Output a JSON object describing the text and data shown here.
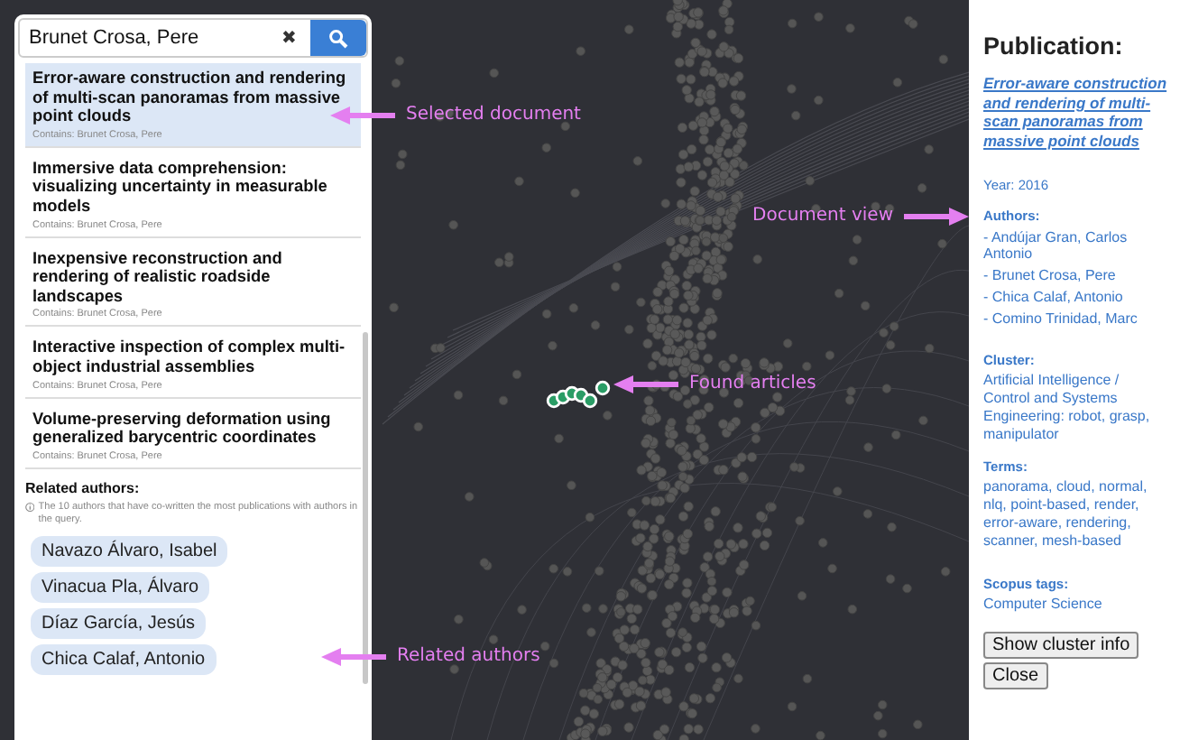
{
  "search": {
    "value": "Brunet Crosa, Pere",
    "clear": "✖"
  },
  "results": [
    {
      "title": "Error-aware construction and rendering of multi-scan panoramas from massive point clouds",
      "contains": "Contains: Brunet Crosa, Pere",
      "selected": true
    },
    {
      "title": "Immersive data comprehension: visualizing uncertainty in measurable models",
      "contains": "Contains: Brunet Crosa, Pere",
      "selected": false
    },
    {
      "title": "Inexpensive reconstruction and rendering of realistic roadside landscapes",
      "contains": "Contains: Brunet Crosa, Pere",
      "selected": false
    },
    {
      "title": "Interactive inspection of complex multi-object industrial assemblies",
      "contains": "Contains: Brunet Crosa, Pere",
      "selected": false
    },
    {
      "title": "Volume-preserving deformation using generalized barycentric coordinates",
      "contains": "Contains: Brunet Crosa, Pere",
      "selected": false
    }
  ],
  "related_authors": {
    "heading": "Related authors:",
    "note": "The 10 authors that have co-written the most publications with authors in the query.",
    "authors": [
      "Navazo Álvaro, Isabel",
      "Vinacua Pla, Álvaro",
      "Díaz García, Jesús",
      "Chica Calaf, Antonio"
    ]
  },
  "publication": {
    "heading": "Publication:",
    "title": "Error-aware construction and rendering of multi-scan panoramas from massive point clouds",
    "year": "Year: 2016",
    "authors_label": "Authors:",
    "authors": [
      "- Andújar Gran, Carlos Antonio",
      "- Brunet Crosa, Pere",
      "- Chica Calaf, Antonio",
      "- Comino Trinidad, Marc"
    ],
    "cluster_label": "Cluster:",
    "cluster": "Artificial Intelligence / Control and Systems Engineering: robot, grasp, manipulator",
    "terms_label": "Terms:",
    "terms": "panorama, cloud, normal, nlq, point-based, render, error-aware, rendering, scanner, mesh-based",
    "scopus_label": "Scopus tags:",
    "scopus": "Computer Science",
    "buttons": [
      "Show cluster info",
      "Close"
    ]
  },
  "annotations": [
    {
      "text": "Selected document",
      "kind": "arrow-left"
    },
    {
      "text": "Document view",
      "kind": "arrow-right"
    },
    {
      "text": "Found articles",
      "kind": "arrow-left"
    },
    {
      "text": "Related authors",
      "kind": "arrow-left"
    }
  ]
}
